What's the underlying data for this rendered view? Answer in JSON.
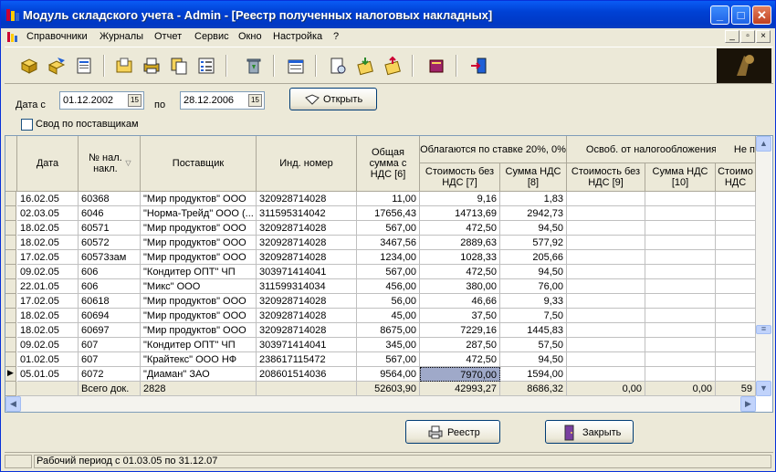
{
  "window": {
    "title": "Модуль складского учета - Admin - [Реестр полученных налоговых накладных]"
  },
  "menu": [
    "Справочники",
    "Журналы",
    "Отчет",
    "Сервис",
    "Окно",
    "Настройка",
    "?"
  ],
  "filter": {
    "date_from_label": "Дата с",
    "date_from": "01.12.2002",
    "date_to_label": "по",
    "date_to": "28.12.2006",
    "open_button": "Открыть",
    "checkbox_label": "Свод по поставщикам"
  },
  "columns": {
    "date": "Дата",
    "num": "№ нал. накл.",
    "supplier": "Поставщик",
    "inn": "Инд. номер",
    "total": "Общая сумма с НДС [6]",
    "group20": "Облагаются по ставке 20%, 0%",
    "cost20": "Стоимость без НДС [7]",
    "vat20": "Сумма НДС [8]",
    "groupfree": "Освоб. от налогообложения",
    "costfree": "Стоимость без НДС [9]",
    "vatfree": "Сумма НДС [10]",
    "groupnot": "Не п",
    "costnot": "Стоимо НДС"
  },
  "rows": [
    [
      "16.02.05",
      "60368",
      "\"Мир продуктов\" ООО",
      "320928714028",
      "11,00",
      "9,16",
      "1,83"
    ],
    [
      "02.03.05",
      "6046",
      "\"Норма-Трейд\" ООО (...",
      "311595314042",
      "17656,43",
      "14713,69",
      "2942,73"
    ],
    [
      "18.02.05",
      "60571",
      "\"Мир продуктов\" ООО",
      "320928714028",
      "567,00",
      "472,50",
      "94,50"
    ],
    [
      "18.02.05",
      "60572",
      "\"Мир продуктов\" ООО",
      "320928714028",
      "3467,56",
      "2889,63",
      "577,92"
    ],
    [
      "17.02.05",
      "60573зам",
      "\"Мир продуктов\" ООО",
      "320928714028",
      "1234,00",
      "1028,33",
      "205,66"
    ],
    [
      "09.02.05",
      "606",
      "\"Кондитер ОПТ\" ЧП",
      "303971414041",
      "567,00",
      "472,50",
      "94,50"
    ],
    [
      "22.01.05",
      "606",
      "\"Микс\" ООО",
      "311599314034",
      "456,00",
      "380,00",
      "76,00"
    ],
    [
      "17.02.05",
      "60618",
      "\"Мир продуктов\" ООО",
      "320928714028",
      "56,00",
      "46,66",
      "9,33"
    ],
    [
      "18.02.05",
      "60694",
      "\"Мир продуктов\" ООО",
      "320928714028",
      "45,00",
      "37,50",
      "7,50"
    ],
    [
      "18.02.05",
      "60697",
      "\"Мир продуктов\" ООО",
      "320928714028",
      "8675,00",
      "7229,16",
      "1445,83"
    ],
    [
      "09.02.05",
      "607",
      "\"Кондитер ОПТ\" ЧП",
      "303971414041",
      "345,00",
      "287,50",
      "57,50"
    ],
    [
      "01.02.05",
      "607",
      "\"Крайтекс\" ООО НФ",
      "238617115472",
      "567,00",
      "472,50",
      "94,50"
    ],
    [
      "05.01.05",
      "6072",
      "\"Диаман\" ЗАО",
      "208601514036",
      "9564,00",
      "7970,00",
      "1594,00"
    ]
  ],
  "totals": {
    "label": "Всего док.",
    "count": "2828",
    "total": "52603,90",
    "cost20": "42993,27",
    "vat20": "8686,32",
    "costfree": "0,00",
    "vatfree": "0,00",
    "costnot": "59"
  },
  "buttons": {
    "registry": "Реестр",
    "close": "Закрыть"
  },
  "status": {
    "text": "Рабочий период с 01.03.05 по 31.12.07"
  }
}
